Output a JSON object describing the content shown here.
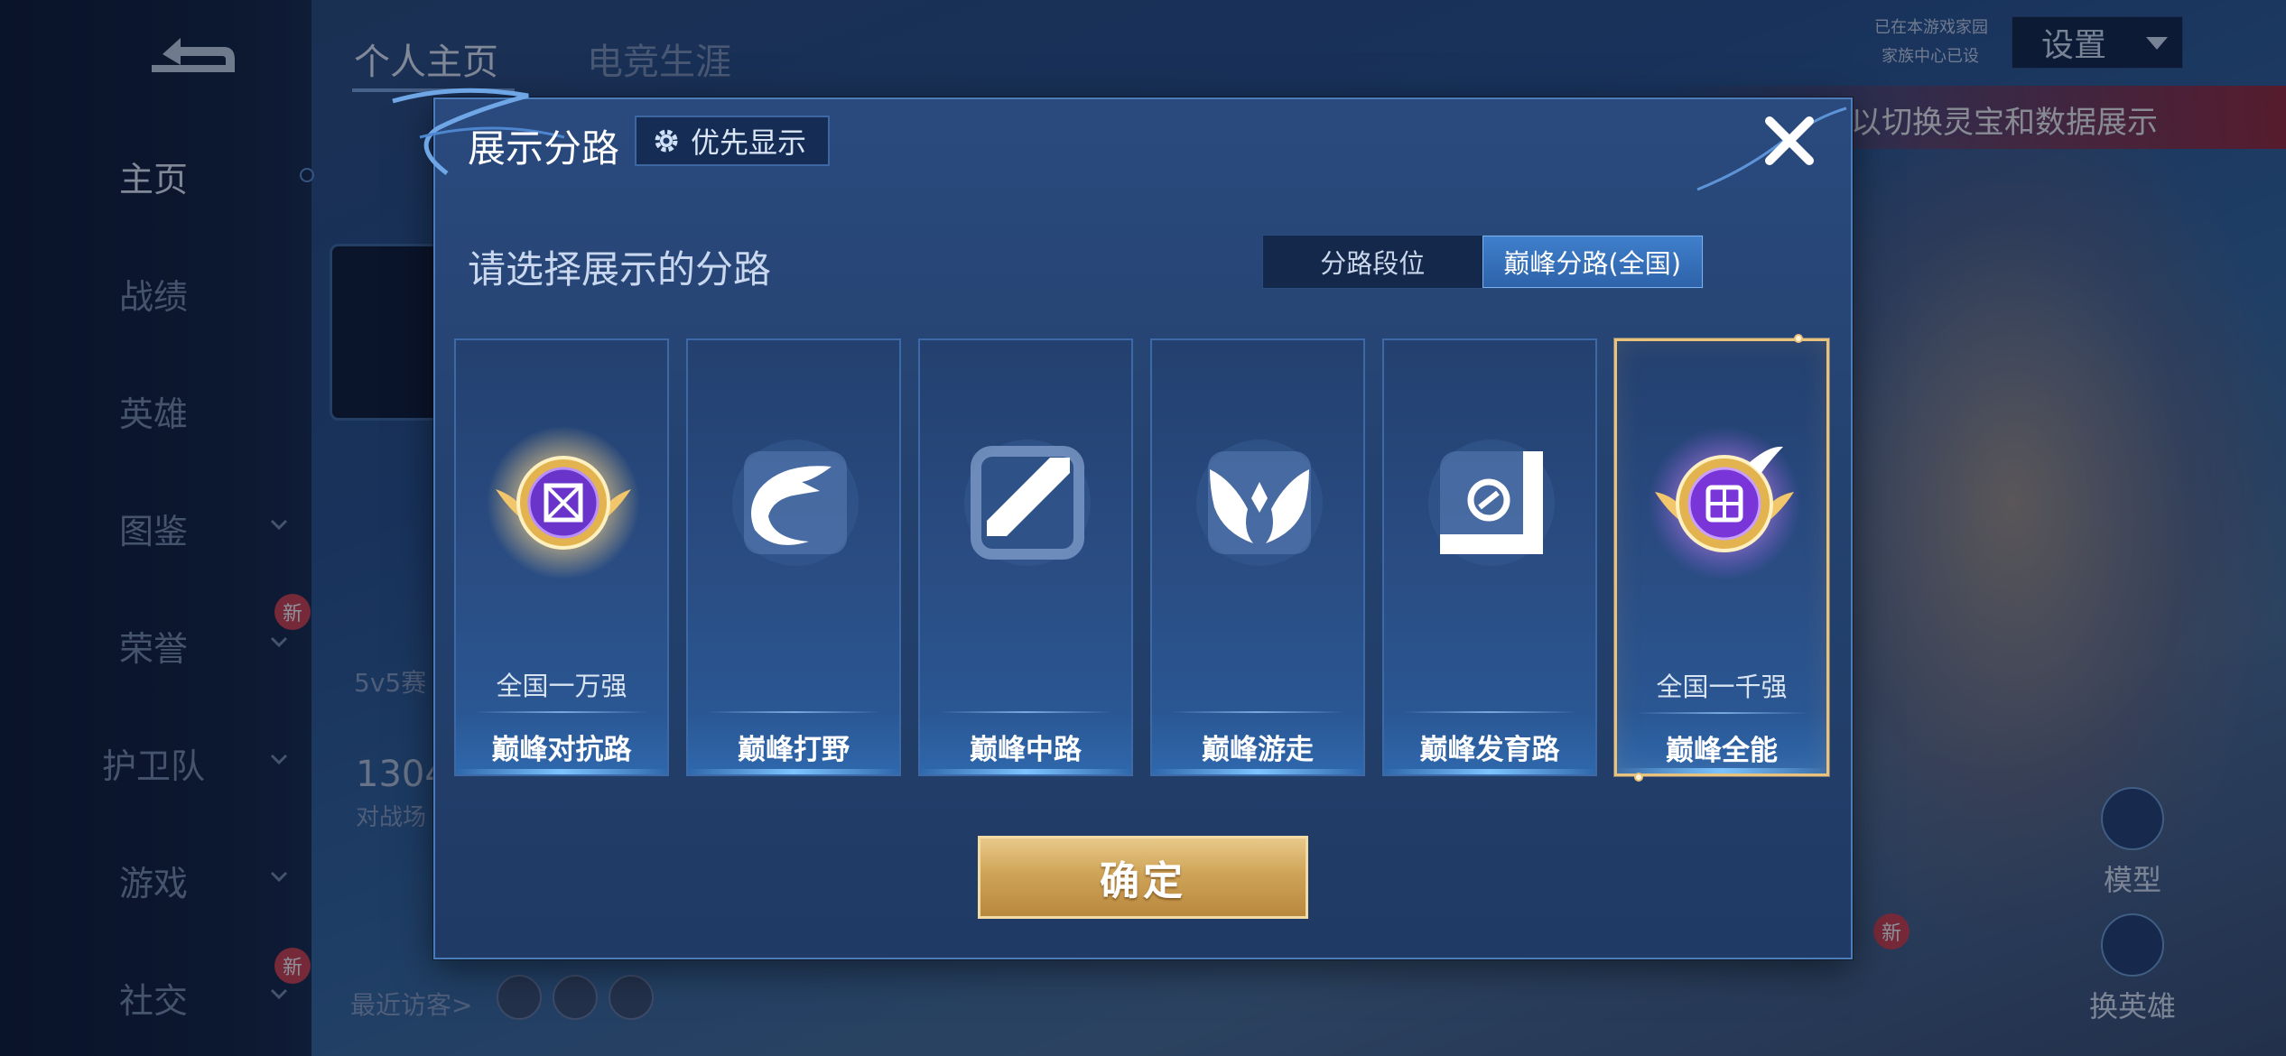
{
  "left_nav": {
    "items": [
      {
        "label": "主页",
        "active": true,
        "has_chevron": false,
        "new_badge": ""
      },
      {
        "label": "战绩",
        "active": false,
        "has_chevron": false,
        "new_badge": ""
      },
      {
        "label": "英雄",
        "active": false,
        "has_chevron": false,
        "new_badge": ""
      },
      {
        "label": "图鉴",
        "active": false,
        "has_chevron": true,
        "new_badge": ""
      },
      {
        "label": "荣誉",
        "active": false,
        "has_chevron": true,
        "new_badge": "新"
      },
      {
        "label": "护卫队",
        "active": false,
        "has_chevron": true,
        "new_badge": ""
      },
      {
        "label": "游戏",
        "active": false,
        "has_chevron": true,
        "new_badge": ""
      },
      {
        "label": "社交",
        "active": false,
        "has_chevron": true,
        "new_badge": "新"
      }
    ]
  },
  "top_tabs": [
    "个人主页",
    "电竞生涯"
  ],
  "background": {
    "banner_text": "以切换灵宝和数据展示",
    "game_mode": "5v5赛",
    "stat_number": "1304",
    "stat_sub": "对战场",
    "recent_visitors": "最近访客>",
    "settings_label": "设置",
    "top_right_line1": "已在本游戏家园",
    "top_right_line2": "家族中心已设",
    "side_buttons": [
      {
        "label": "模型",
        "icon": "figure-icon"
      },
      {
        "label": "换英雄",
        "icon": "swap-hero-icon"
      }
    ],
    "extra_new_badge": "新"
  },
  "modal": {
    "title": "展示分路",
    "priority_button": "优先显示",
    "prompt": "请选择展示的分路",
    "segments": [
      {
        "label": "分路段位",
        "selected": false
      },
      {
        "label": "巅峰分路(全国)",
        "selected": true
      }
    ],
    "cards": [
      {
        "name": "巅峰对抗路",
        "rank": "全国一万强",
        "icon": "clash-lane-gold-badge-icon",
        "selected": false
      },
      {
        "name": "巅峰打野",
        "rank": "",
        "icon": "jungle-dragon-icon",
        "selected": false
      },
      {
        "name": "巅峰中路",
        "rank": "",
        "icon": "mid-lane-icon",
        "selected": false
      },
      {
        "name": "巅峰游走",
        "rank": "",
        "icon": "roam-wings-icon",
        "selected": false
      },
      {
        "name": "巅峰发育路",
        "rank": "",
        "icon": "farm-lane-icon",
        "selected": false
      },
      {
        "name": "巅峰全能",
        "rank": "全国一千强",
        "icon": "all-round-gold-badge-icon",
        "selected": true
      }
    ],
    "confirm_button": "确定"
  },
  "colors": {
    "accent_gold": "#e9c27c",
    "panel_blue": "#24426f",
    "segment_selected": "#3f7fcc",
    "badge_red": "#d2414d"
  }
}
